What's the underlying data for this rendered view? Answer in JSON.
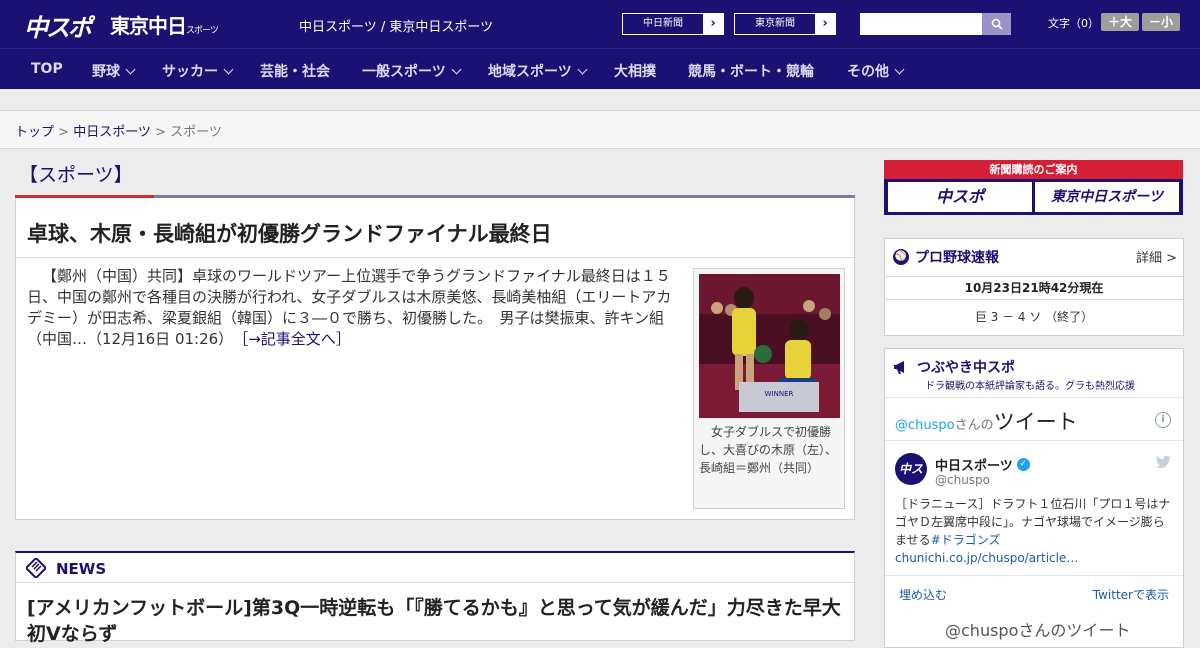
{
  "header": {
    "logo_main": "中スポ",
    "logo_sub": "東京中日",
    "logo_sub_small": "スポーツ",
    "site_title": "中日スポーツ / 東京中日スポーツ",
    "newspaper_links": [
      {
        "label": "中日新聞",
        "arrow": "›"
      },
      {
        "label": "東京新聞",
        "arrow": "›"
      }
    ],
    "search": {
      "placeholder": "",
      "icon": "search-icon"
    },
    "font_size": {
      "label": "文字（0）",
      "increase": "＋大",
      "decrease": "－小"
    }
  },
  "nav": {
    "items": [
      {
        "label": "TOP",
        "has_menu": false
      },
      {
        "label": "野球",
        "has_menu": true
      },
      {
        "label": "サッカー",
        "has_menu": true
      },
      {
        "label": "芸能・社会",
        "has_menu": false
      },
      {
        "label": "一般スポーツ",
        "has_menu": true
      },
      {
        "label": "地域スポーツ",
        "has_menu": true
      },
      {
        "label": "大相撲",
        "has_menu": false
      },
      {
        "label": "競馬・ボート・競輪",
        "has_menu": false
      },
      {
        "label": "その他",
        "has_menu": true
      }
    ]
  },
  "breadcrumb": {
    "top": "トップ",
    "sep": " > ",
    "parent": "中日スポーツ",
    "current": "スポーツ"
  },
  "section": {
    "title": "【スポーツ】"
  },
  "article": {
    "headline": "卓球、木原・長崎組が初優勝グランドファイナル最終日",
    "body": "【鄭州（中国）共同】卓球のワールドツアー上位選手で争うグランドファイナル最終日は１５日、中国の鄭州で各種目の決勝が行われ、女子ダブルスは木原美悠、長崎美柚組（エリートアカデミー）が田志希、梁夏銀組（韓国）に３―０で勝ち、初優勝した。　男子は樊振東、許キン組（中国…（12月16日 01:26）",
    "more_link": "［→記事全文へ］",
    "photo_caption": "女子ダブルスで初優勝し、大喜びの木原（左）、長崎組＝鄭州（共同）",
    "photo_board_text": "WINNER"
  },
  "news": {
    "heading": "NEWS",
    "items": [
      "[アメリカンフットボール]第3Q一時逆転も「『勝てるかも』と思って気が緩んだ」力尽きた早大初Vならず"
    ]
  },
  "sidebar": {
    "subscribe": {
      "label": "新聞購読のご案内",
      "logo1": "中スポ",
      "logo2": "東京中日スポーツ"
    },
    "baseball": {
      "title": "プロ野球速報",
      "detail": "詳細 >",
      "timestamp": "10月23日21時42分現在",
      "score": "巨 3 － 4 ソ （終了）"
    },
    "twitter": {
      "title": "つぶやき中スポ",
      "subtitle": "ドラ観戦の本紙評論家も語る。グラも熱烈応援",
      "embed_handle": "@chuspo",
      "embed_san": "さんの",
      "embed_tweet": "ツイート",
      "user_name": "中日スポーツ",
      "user_handle": "@chuspo",
      "tweet_text": "［ドラニュース］ドラフト１位石川「プロ１号はナゴヤＤ左翼席中段に」。ナゴヤ球場でイメージ膨らませる",
      "tweet_hashtag": "#ドラゴンズ",
      "tweet_link": "chunichi.co.jp/chuspo/article…",
      "embed_link": "埋め込む",
      "view_link": "Twitterで表示",
      "more_tweets": "@chuspoさんのツイート"
    }
  }
}
